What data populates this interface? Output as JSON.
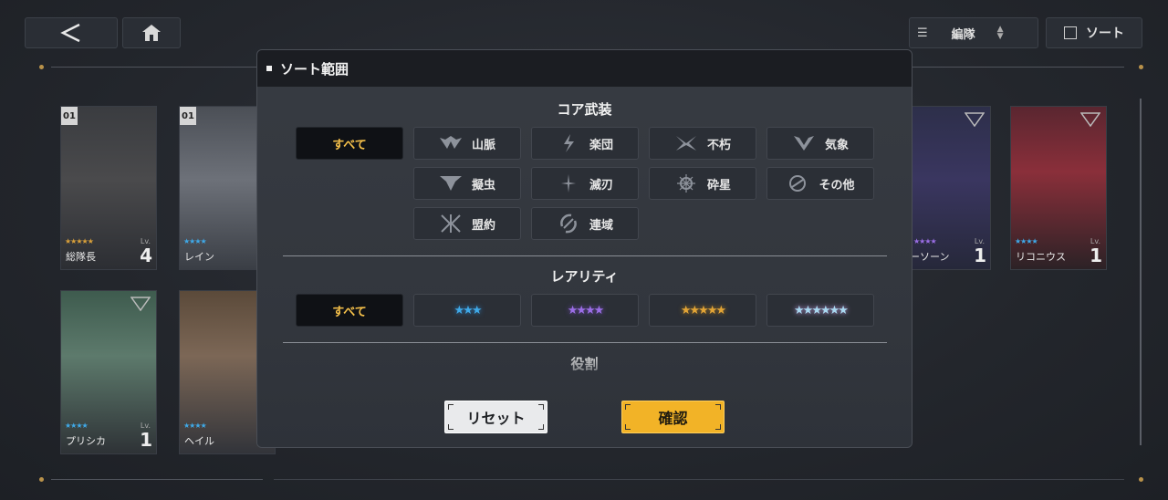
{
  "top_bar": {
    "back_icon": "chevron-left-icon",
    "home_icon": "home-icon",
    "formation_label": "編隊",
    "sort_label": "ソート"
  },
  "cards": [
    {
      "badge": "01",
      "name": "総隊長",
      "level": "4",
      "lv_label": "Lv.",
      "stars": "★★★★★"
    },
    {
      "badge": "01",
      "name": "レイン",
      "level": "",
      "lv_label": "",
      "stars": "★★★★"
    },
    {
      "badge": "",
      "name": "ーソーン",
      "level": "1",
      "lv_label": "Lv.",
      "stars": "★★★★"
    },
    {
      "badge": "",
      "name": "リコニウス",
      "level": "1",
      "lv_label": "Lv.",
      "stars": "★★★★"
    },
    {
      "badge": "",
      "name": "プリシカ",
      "level": "1",
      "lv_label": "Lv.",
      "stars": "★★★★"
    },
    {
      "badge": "",
      "name": "ヘイル",
      "level": "",
      "lv_label": "",
      "stars": "★★★★"
    }
  ],
  "modal": {
    "title": "ソート範囲",
    "core_section": {
      "title": "コア武装",
      "options": [
        {
          "label": "すべて",
          "icon": "",
          "selected": true
        },
        {
          "label": "山脈",
          "icon": "mountain-icon",
          "selected": false
        },
        {
          "label": "楽団",
          "icon": "orchestra-icon",
          "selected": false
        },
        {
          "label": "不朽",
          "icon": "immortal-icon",
          "selected": false
        },
        {
          "label": "気象",
          "icon": "weather-icon",
          "selected": false
        },
        {
          "label": "擬虫",
          "icon": "insect-icon",
          "selected": false
        },
        {
          "label": "滅刃",
          "icon": "blade-icon",
          "selected": false
        },
        {
          "label": "砕星",
          "icon": "star-breaker-icon",
          "selected": false
        },
        {
          "label": "その他",
          "icon": "other-icon",
          "selected": false
        },
        {
          "label": "盟約",
          "icon": "covenant-icon",
          "selected": false
        },
        {
          "label": "連域",
          "icon": "link-icon",
          "selected": false
        }
      ]
    },
    "rarity_section": {
      "title": "レアリティ",
      "options": [
        {
          "label": "すべて",
          "stars": "",
          "color": "",
          "selected": true
        },
        {
          "label": "",
          "stars": "★★★",
          "color": "#3fa9e8",
          "selected": false
        },
        {
          "label": "",
          "stars": "★★★★",
          "color": "#9b6ee6",
          "selected": false
        },
        {
          "label": "",
          "stars": "★★★★★",
          "color": "#e2a436",
          "selected": false
        },
        {
          "label": "",
          "stars": "★★★★★★",
          "color": "#a9d8f0",
          "selected": false
        }
      ]
    },
    "role_section": {
      "title": "役割"
    },
    "reset_label": "リセット",
    "confirm_label": "確認"
  },
  "colors": {
    "accent_gold": "#f2b327",
    "selected_text": "#f6c14a"
  }
}
